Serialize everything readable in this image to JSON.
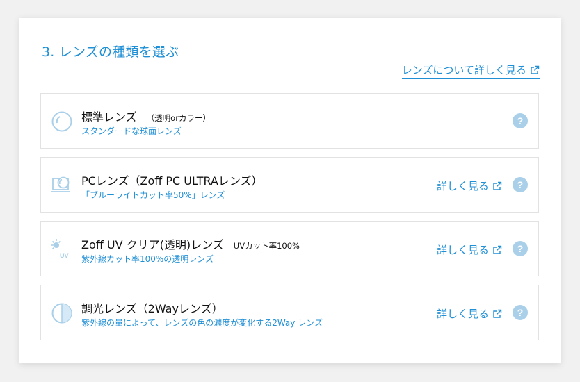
{
  "section": {
    "title": "3. レンズの種類を選ぶ",
    "learn_more": "レンズについて詳しく見る"
  },
  "options": [
    {
      "icon": "standard-lens-icon",
      "name": "標準レンズ",
      "note": "（透明orカラー）",
      "desc": "スタンダードな球面レンズ",
      "detail": "",
      "help": "?"
    },
    {
      "icon": "pc-lens-icon",
      "name": "PCレンズ（Zoff PC ULTRAレンズ）",
      "note": "",
      "desc": "「ブルーライトカット率50%」レンズ",
      "detail": "詳しく見る",
      "help": "?"
    },
    {
      "icon": "uv-lens-icon",
      "name": "Zoff UV クリア(透明)レンズ",
      "note": "UVカット率100%",
      "desc": "紫外線カット率100%の透明レンズ",
      "detail": "詳しく見る",
      "help": "?"
    },
    {
      "icon": "photochromic-lens-icon",
      "name": "調光レンズ（2Wayレンズ）",
      "note": "",
      "desc": "紫外線の量によって、レンズの色の濃度が変化する2Way レンズ",
      "detail": "詳しく見る",
      "help": "?"
    }
  ],
  "colors": {
    "accent": "#1f8fd6",
    "help_bg": "#a9cfe9",
    "border": "#e2e2e2"
  }
}
